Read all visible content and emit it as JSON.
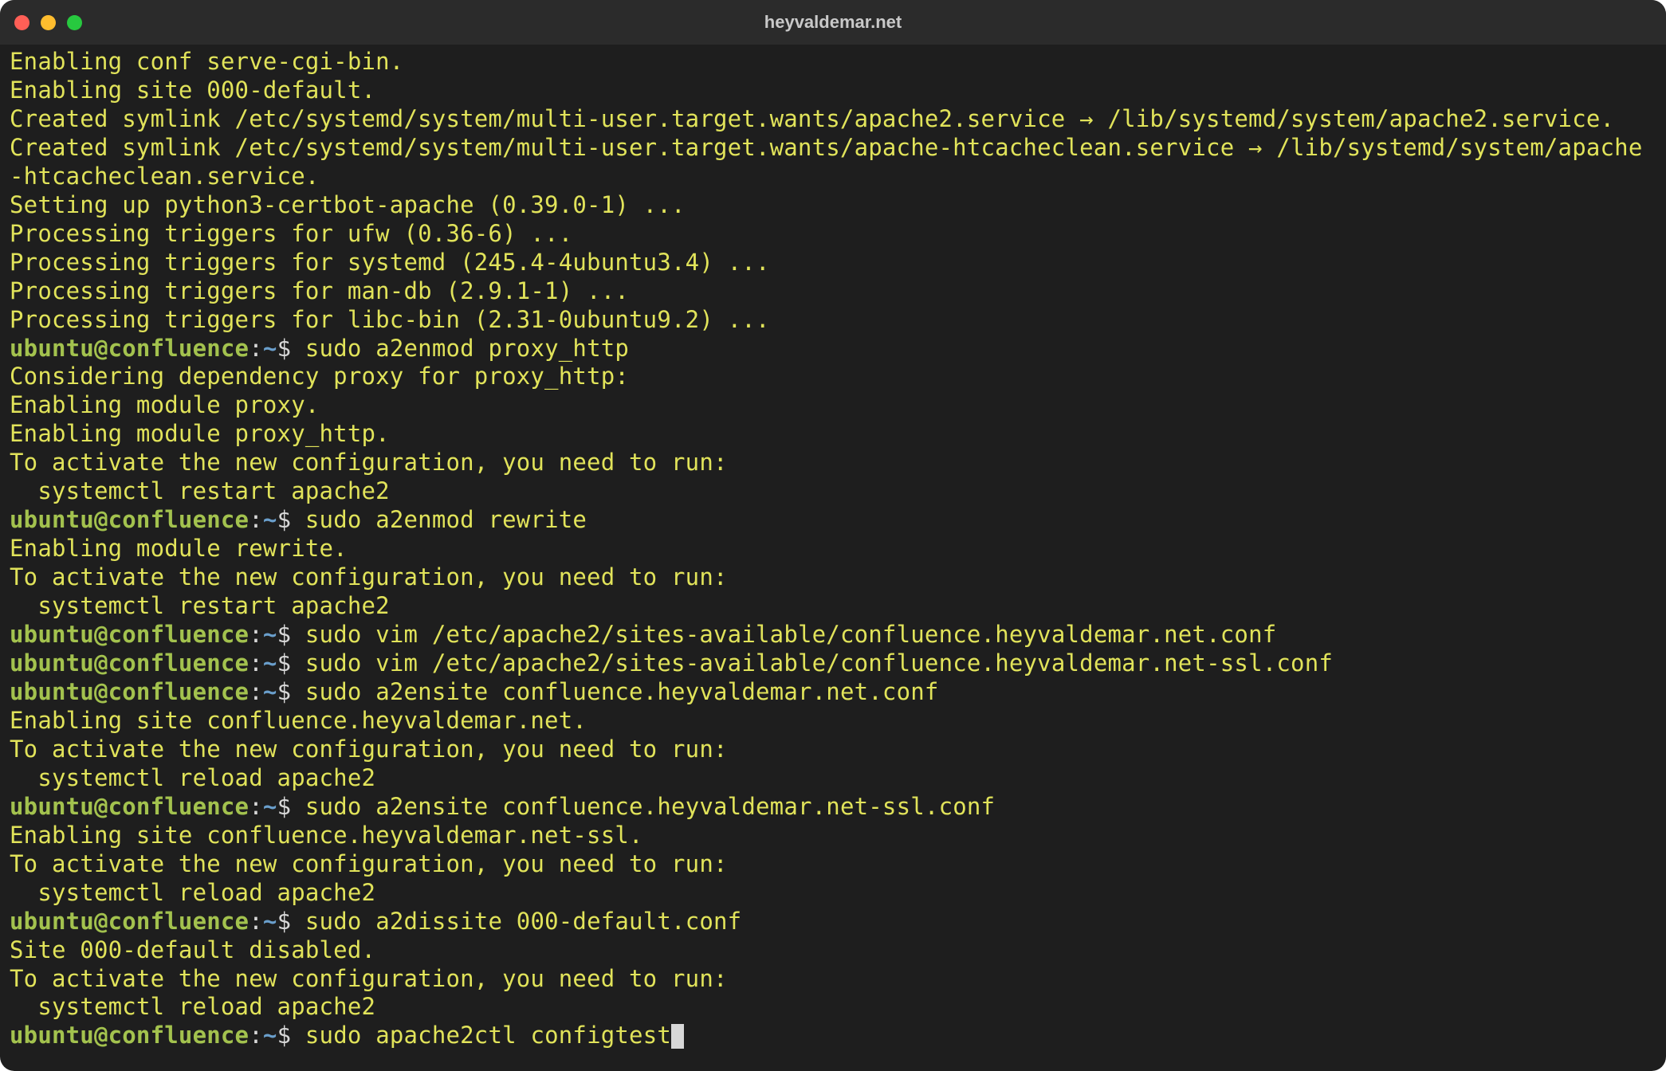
{
  "window": {
    "title": "heyvaldemar.net"
  },
  "prompt": {
    "user_host": "ubuntu@confluence",
    "sep": ":",
    "path": "~",
    "dollar": "$"
  },
  "blocks": [
    {
      "type": "out",
      "text": "Enabling conf serve-cgi-bin."
    },
    {
      "type": "out",
      "text": "Enabling site 000-default."
    },
    {
      "type": "out",
      "text": "Created symlink /etc/systemd/system/multi-user.target.wants/apache2.service → /lib/systemd/system/apache2.service."
    },
    {
      "type": "out",
      "text": "Created symlink /etc/systemd/system/multi-user.target.wants/apache-htcacheclean.service → /lib/systemd/system/apache-htcacheclean.service."
    },
    {
      "type": "out",
      "text": "Setting up python3-certbot-apache (0.39.0-1) ..."
    },
    {
      "type": "out",
      "text": "Processing triggers for ufw (0.36-6) ..."
    },
    {
      "type": "out",
      "text": "Processing triggers for systemd (245.4-4ubuntu3.4) ..."
    },
    {
      "type": "out",
      "text": "Processing triggers for man-db (2.9.1-1) ..."
    },
    {
      "type": "out",
      "text": "Processing triggers for libc-bin (2.31-0ubuntu9.2) ..."
    },
    {
      "type": "cmd",
      "text": "sudo a2enmod proxy_http"
    },
    {
      "type": "out",
      "text": "Considering dependency proxy for proxy_http:"
    },
    {
      "type": "out",
      "text": "Enabling module proxy."
    },
    {
      "type": "out",
      "text": "Enabling module proxy_http."
    },
    {
      "type": "out",
      "text": "To activate the new configuration, you need to run:"
    },
    {
      "type": "out",
      "text": "  systemctl restart apache2"
    },
    {
      "type": "cmd",
      "text": "sudo a2enmod rewrite"
    },
    {
      "type": "out",
      "text": "Enabling module rewrite."
    },
    {
      "type": "out",
      "text": "To activate the new configuration, you need to run:"
    },
    {
      "type": "out",
      "text": "  systemctl restart apache2"
    },
    {
      "type": "cmd",
      "text": "sudo vim /etc/apache2/sites-available/confluence.heyvaldemar.net.conf"
    },
    {
      "type": "cmd",
      "text": "sudo vim /etc/apache2/sites-available/confluence.heyvaldemar.net-ssl.conf"
    },
    {
      "type": "cmd",
      "text": "sudo a2ensite confluence.heyvaldemar.net.conf"
    },
    {
      "type": "out",
      "text": "Enabling site confluence.heyvaldemar.net."
    },
    {
      "type": "out",
      "text": "To activate the new configuration, you need to run:"
    },
    {
      "type": "out",
      "text": "  systemctl reload apache2"
    },
    {
      "type": "cmd",
      "text": "sudo a2ensite confluence.heyvaldemar.net-ssl.conf"
    },
    {
      "type": "out",
      "text": "Enabling site confluence.heyvaldemar.net-ssl."
    },
    {
      "type": "out",
      "text": "To activate the new configuration, you need to run:"
    },
    {
      "type": "out",
      "text": "  systemctl reload apache2"
    },
    {
      "type": "cmd",
      "text": "sudo a2dissite 000-default.conf"
    },
    {
      "type": "out",
      "text": "Site 000-default disabled."
    },
    {
      "type": "out",
      "text": "To activate the new configuration, you need to run:"
    },
    {
      "type": "out",
      "text": "  systemctl reload apache2"
    },
    {
      "type": "cmd",
      "text": "sudo apache2ctl configtest",
      "cursor": true
    }
  ]
}
